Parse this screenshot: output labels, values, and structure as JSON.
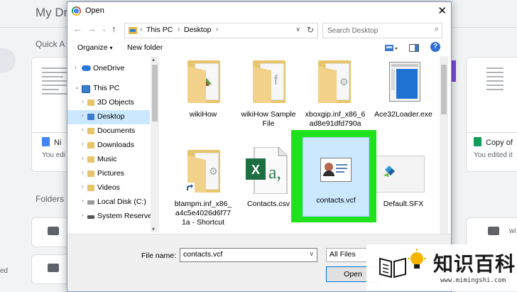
{
  "background": {
    "page_title": "My Dri",
    "quick_access": "Quick A",
    "folders_label": "Folders",
    "cards": [
      {
        "name": "Ni",
        "sub": "You edi"
      },
      {
        "name": "Copy of",
        "sub": "You edited it"
      }
    ],
    "folder_fragment": "wi",
    "edge_fragment": "ed"
  },
  "dialog": {
    "title": "Open",
    "address": {
      "crumbs": [
        "This PC",
        "Desktop"
      ]
    },
    "search_placeholder": "Search Desktop",
    "toolbar": {
      "organize": "Organize",
      "new_folder": "New folder"
    },
    "nav_items": [
      {
        "label": "OneDrive",
        "icon": "cloud-icon"
      },
      {
        "label": "This PC",
        "icon": "computer-icon"
      },
      {
        "label": "3D Objects",
        "icon": "cube-icon"
      },
      {
        "label": "Desktop",
        "icon": "desktop-icon"
      },
      {
        "label": "Documents",
        "icon": "documents-icon"
      },
      {
        "label": "Downloads",
        "icon": "downloads-icon"
      },
      {
        "label": "Music",
        "icon": "music-icon"
      },
      {
        "label": "Pictures",
        "icon": "pictures-icon"
      },
      {
        "label": "Videos",
        "icon": "videos-icon"
      },
      {
        "label": "Local Disk (C:)",
        "icon": "disk-icon"
      },
      {
        "label": "System Reserved",
        "icon": "drive-icon"
      }
    ],
    "files": [
      {
        "label": "wikiHow",
        "type": "folder"
      },
      {
        "label": "wikiHow Sample File",
        "type": "folder"
      },
      {
        "label": "xboxgip.inf_x86_6ad8e91dfd790a",
        "type": "folder"
      },
      {
        "label": "Ace32Loader.exe",
        "type": "exe"
      },
      {
        "label": "btampm.inf_x86_a4c5e4026d6f771a - Shortcut",
        "type": "shortcut"
      },
      {
        "label": "Contacts.csv",
        "type": "csv"
      },
      {
        "label": "contacts.vcf",
        "type": "vcf",
        "selected": true
      },
      {
        "label": "Default.SFX",
        "type": "sfx"
      }
    ],
    "file_name_label": "File name:",
    "file_name_value": "contacts.vcf",
    "file_type": "All Files",
    "open_button": "Open"
  },
  "watermark": {
    "text": "知识百科",
    "url": "www.mimingshi.com"
  }
}
